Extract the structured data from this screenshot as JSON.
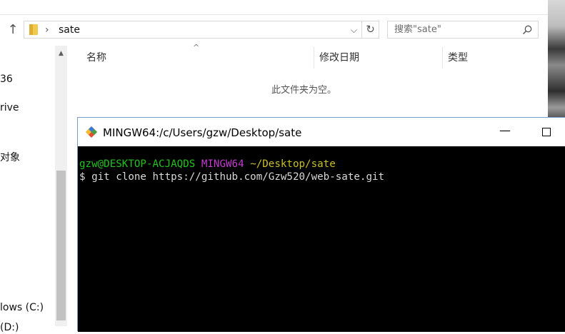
{
  "explorer": {
    "address": {
      "path": "sate"
    },
    "search": {
      "placeholder": "搜索\"sate\""
    },
    "nav_items": [
      "36",
      "rive",
      "对象",
      "lows (C:)",
      "(D:)"
    ],
    "columns": [
      "名称",
      "修改日期",
      "类型"
    ],
    "empty_message": "此文件夹为空。"
  },
  "terminal": {
    "title": "MINGW64:/c/Users/gzw/Desktop/sate",
    "prompt": {
      "user_host": "gzw@DESKTOP-ACJAQDS",
      "shell": "MINGW64",
      "path": "~/Desktop/sate"
    },
    "command": "$ git clone https://github.com/Gzw520/web-sate.git"
  },
  "colors": {
    "prompt_user": "#21c21e",
    "prompt_shell": "#c43ad0",
    "prompt_path": "#c9bf2a",
    "terminal_bg": "#000000"
  },
  "icons": {
    "up": "up-arrow-icon",
    "folder": "folder-icon",
    "refresh": "refresh-icon",
    "search": "search-icon",
    "git": "git-icon"
  }
}
